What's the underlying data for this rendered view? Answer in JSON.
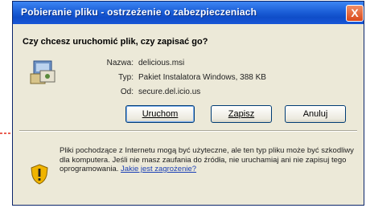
{
  "dialog": {
    "title": "Pobieranie pliku - ostrzeżenie o zabezpieczeniach",
    "close_label": "X",
    "question": "Czy chcesz uruchomić plik, czy zapisać go?",
    "file": {
      "name_label": "Nazwa:",
      "name_value": "delicious.msi",
      "type_label": "Typ:",
      "type_value": "Pakiet Instalatora Windows, 388 KB",
      "from_label": "Od:",
      "from_value": "secure.del.icio.us"
    },
    "buttons": {
      "run": "Uruchom",
      "save": "Zapisz",
      "cancel": "Anuluj"
    },
    "warning": {
      "text": "Pliki pochodzące z Internetu mogą być użyteczne, ale ten typ pliku może być szkodliwy dla komputera. Jeśli nie masz zaufania do źródła, nie uruchamiaj ani nie zapisuj tego oprogramowania.",
      "link": "Jakie jest zagrożenie?"
    }
  },
  "colors": {
    "titlebar": "#1c5fd8",
    "close_button": "#d9481a",
    "dialog_background": "#ece9d8",
    "arrow": "#e32a1c",
    "link": "#1a3fb5"
  },
  "icons": {
    "file": "installer-package-icon",
    "warning": "shield-warning-icon",
    "close": "close-icon"
  }
}
